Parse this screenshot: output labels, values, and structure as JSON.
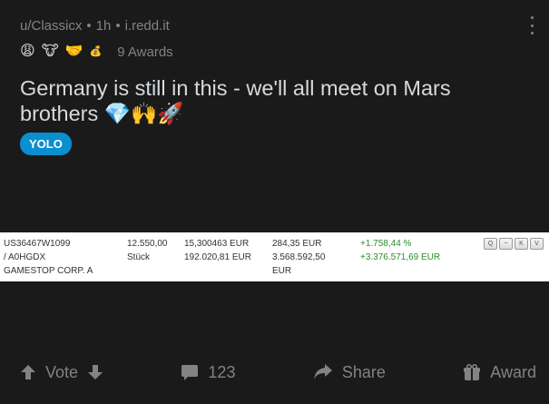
{
  "post": {
    "username": "u/Classicx",
    "time": "1h",
    "domain": "i.redd.it",
    "awards": {
      "icons": [
        "😩",
        "🐮",
        "🤝",
        "💰"
      ],
      "count_label": "9 Awards"
    },
    "title": "Germany is still in this - we'll all meet on Mars brothers 💎🙌🚀",
    "flair": "YOLO"
  },
  "table": {
    "col1": [
      "US36467W1099",
      "/ A0HGDX",
      "GAMESTOP CORP. A"
    ],
    "col2": [
      "12.550,00",
      "Stück"
    ],
    "col3": [
      "15,300463 EUR",
      "192.020,81 EUR"
    ],
    "col4": [
      "284,35 EUR",
      "3.568.592,50",
      "EUR"
    ],
    "col5": [
      "+1.758,44 %",
      "+3.376.571,69 EUR"
    ],
    "buttons": [
      "Q",
      "~",
      "K",
      "V"
    ]
  },
  "actions": {
    "vote": "Vote",
    "comments": "123",
    "share": "Share",
    "award": "Award"
  },
  "colors": {
    "background": "#1a1a1b",
    "flair": "#0a8fd0",
    "gain": "#2e8b2e"
  }
}
